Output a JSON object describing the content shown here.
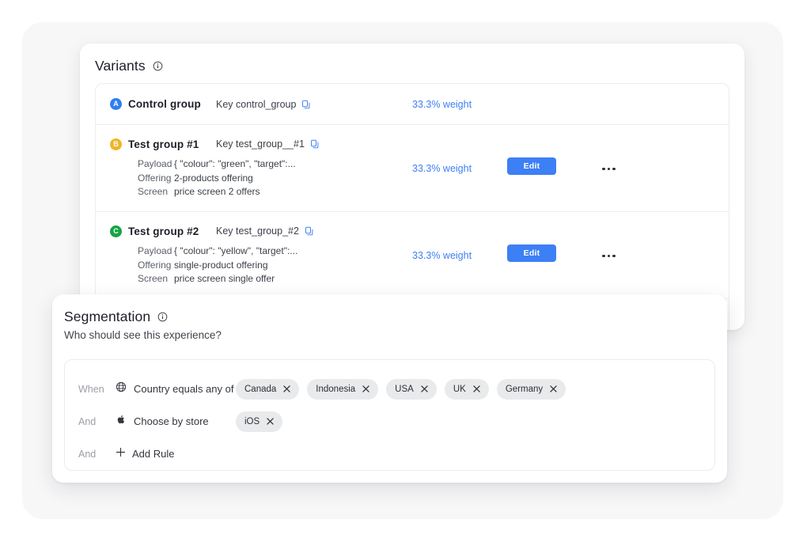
{
  "variants": {
    "title": "Variants",
    "info_icon": "info-circle-icon",
    "columns": {
      "payload": "Payload",
      "offering": "Offering",
      "screen": "Screen"
    },
    "rows": [
      {
        "badge": "A",
        "badge_color": "#2f7ef0",
        "name": "Control group",
        "key_label": "Key control_group",
        "copy_icon": "copy-icon",
        "weight": "33.3% weight",
        "edit_label": "",
        "details": null
      },
      {
        "badge": "B",
        "badge_color": "#f0b429",
        "name": "Test  group #1",
        "key_label": "Key test_group__#1",
        "copy_icon": "copy-icon",
        "weight": "33.3% weight",
        "edit_label": "Edit",
        "details": {
          "payload": "{ \"colour\": \"green\", \"target\":...",
          "offering": "2-products offering",
          "screen": "price screen 2 offers"
        }
      },
      {
        "badge": "C",
        "badge_color": "#14a544",
        "name": "Test  group #2",
        "key_label": "Key test_group_#2",
        "copy_icon": "copy-icon",
        "weight": "33.3% weight",
        "edit_label": "Edit",
        "details": {
          "payload": "{ \"colour\": \"yellow\", \"target\":...",
          "offering": "single-product offering",
          "screen": "price screen single offer"
        }
      }
    ]
  },
  "segmentation": {
    "title": "Segmentation",
    "info_icon": "info-circle-icon",
    "subtitle": "Who should see this experience?",
    "rules": [
      {
        "conjunction": "When",
        "icon": "globe-icon",
        "condition": "Country equals any of",
        "chips": [
          "Canada",
          "Indonesia",
          "USA",
          "UK",
          "Germany"
        ]
      },
      {
        "conjunction": "And",
        "icon": "apple-icon",
        "condition": "Choose by store",
        "chips": [
          "iOS"
        ]
      }
    ],
    "add_rule": {
      "conjunction": "And",
      "icon": "plus-icon",
      "label": "Add Rule"
    }
  },
  "colors": {
    "accent_blue": "#3d7ff5",
    "chip_bg": "#e9eaec",
    "backdrop": "#f7f7f8"
  }
}
